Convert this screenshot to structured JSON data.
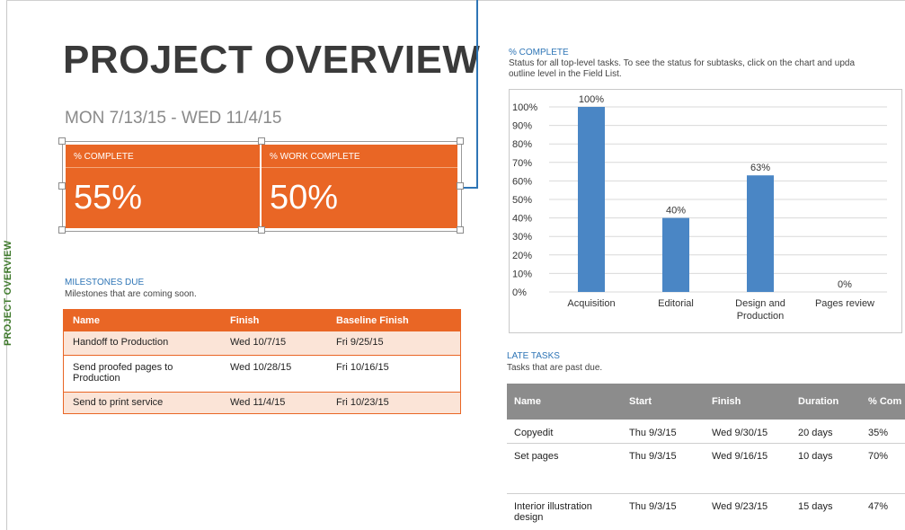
{
  "sidebar": {
    "label": "PROJECT OVERVIEW"
  },
  "header": {
    "title": "PROJECT OVERVIEW",
    "date_range": "MON 7/13/15 -   WED 11/4/15"
  },
  "kpis": [
    {
      "label": "% COMPLETE",
      "value": "55%",
      "fraction": 0.55
    },
    {
      "label": "% WORK COMPLETE",
      "value": "50%",
      "fraction": 0.5
    }
  ],
  "milestones": {
    "title": "MILESTONES DUE",
    "subtitle": "Milestones that are coming soon.",
    "columns": [
      "Name",
      "Finish",
      "Baseline Finish"
    ],
    "rows": [
      {
        "name": "Handoff to Production",
        "finish": "Wed 10/7/15",
        "baseline": "Fri 9/25/15"
      },
      {
        "name": "Send proofed pages to Production",
        "finish": "Wed 10/28/15",
        "baseline": "Fri 10/16/15"
      },
      {
        "name": "Send to print service",
        "finish": "Wed 11/4/15",
        "baseline": "Fri 10/23/15"
      }
    ]
  },
  "complete_section": {
    "title": "% COMPLETE",
    "description_line1": "Status for all top-level tasks. To see the status for subtasks, click on the chart and upda",
    "description_line2": "outline level in the Field List."
  },
  "chart_data": {
    "type": "bar",
    "categories": [
      "Acquisition",
      "Editorial",
      "Design and Production",
      "Pages review"
    ],
    "category_lines": [
      [
        "Acquisition"
      ],
      [
        "Editorial"
      ],
      [
        "Design and",
        "Production"
      ],
      [
        "Pages review"
      ]
    ],
    "values": [
      100,
      40,
      63,
      0
    ],
    "data_labels": [
      "100%",
      "40%",
      "63%",
      "0%"
    ],
    "y_ticks": [
      "0%",
      "10%",
      "20%",
      "30%",
      "40%",
      "50%",
      "60%",
      "70%",
      "80%",
      "90%",
      "100%"
    ],
    "ylim": [
      0,
      100
    ],
    "grid": true,
    "bar_color": "#4a86c5"
  },
  "late_tasks": {
    "title": "LATE TASKS",
    "subtitle": "Tasks that are past due.",
    "columns": [
      "Name",
      "Start",
      "Finish",
      "Duration",
      "% Com"
    ],
    "rows": [
      {
        "name": "Copyedit",
        "start": "Thu 9/3/15",
        "finish": "Wed 9/30/15",
        "duration": "20 days",
        "pct": "35%"
      },
      {
        "name": "Set pages",
        "start": "Thu 9/3/15",
        "finish": "Wed 9/16/15",
        "duration": "10 days",
        "pct": "70%"
      },
      {
        "name": "Interior illustration design",
        "start": "Thu 9/3/15",
        "finish": "Wed 9/23/15",
        "duration": "15 days",
        "pct": "47%"
      }
    ]
  },
  "colors": {
    "accent_orange": "#e96625",
    "accent_blue": "#2e75b6",
    "sidebar_green": "#3f7a2c",
    "table_header_gray": "#8c8c8c"
  }
}
